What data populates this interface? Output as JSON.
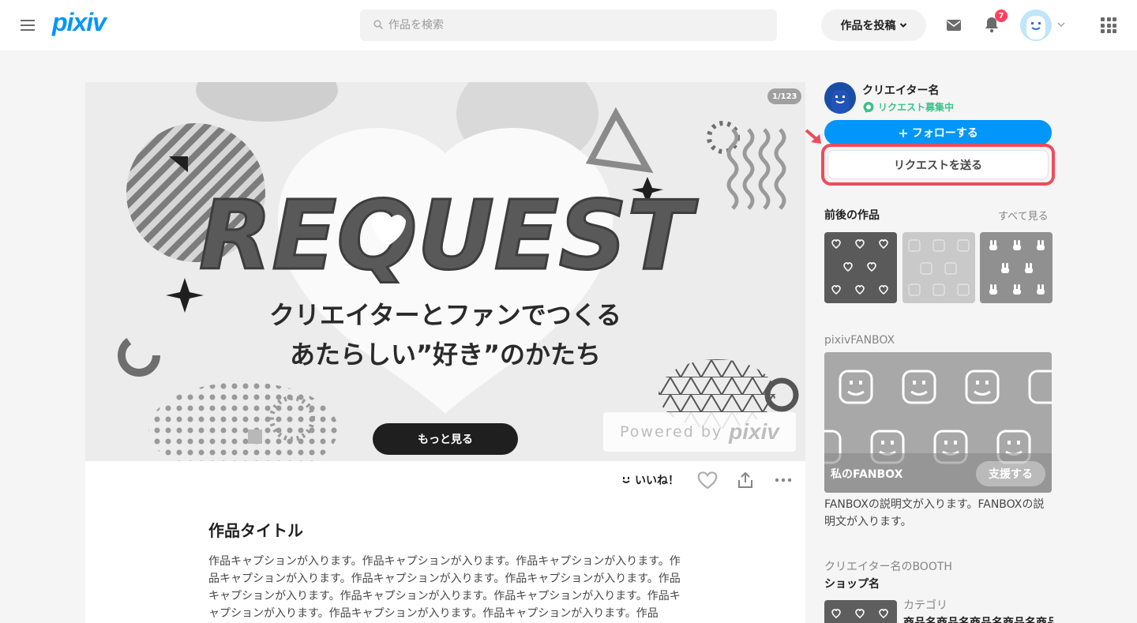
{
  "header": {
    "logo": "pixiv",
    "search_placeholder": "作品を検索",
    "post_button": "作品を投稿",
    "notification_count": "7"
  },
  "artwork": {
    "page_counter": "1/123",
    "image_headline": "REQUEST",
    "image_tagline_1": "クリエイターとファンでつくる",
    "image_tagline_2": "あたらしい”好き”のかたち",
    "powered_by": "Powered by",
    "powered_brand": "pixiv",
    "more_button": "もっと見る"
  },
  "actions": {
    "iine_label": "いいね！"
  },
  "work": {
    "title": "作品タイトル",
    "caption": "作品キャプションが入ります。作品キャプションが入ります。作品キャプションが入ります。作品キャプションが入ります。作品キャプションが入ります。作品キャプションが入ります。作品キャプションが入ります。作品キャプションが入ります。作品キャプションが入ります。作品キャプションが入ります。作品キャプションが入ります。作品キャプションが入ります。作品"
  },
  "sidebar": {
    "creator_name": "クリエイター名",
    "request_status": "リクエスト募集中",
    "follow_button": "フォローする",
    "request_button": "リクエストを送る",
    "related_title": "前後の作品",
    "see_all": "すべて見る",
    "fanbox_section": "pixivFANBOX",
    "fanbox_name": "私のFANBOX",
    "support_button": "支援する",
    "fanbox_description": "FANBOXの説明文が入ります。FANBOXの説明文が入ります。",
    "booth_section": "クリエイター名のBOOTH",
    "shop_name": "ショップ名",
    "booth_category": "カテゴリ",
    "booth_item": "商品名商品名商品名商品名商品名"
  },
  "colors": {
    "accent": "#0096fa",
    "highlight_frame": "#f04b5a",
    "request_green": "#3cc28a",
    "badge_red": "#ff4060"
  }
}
